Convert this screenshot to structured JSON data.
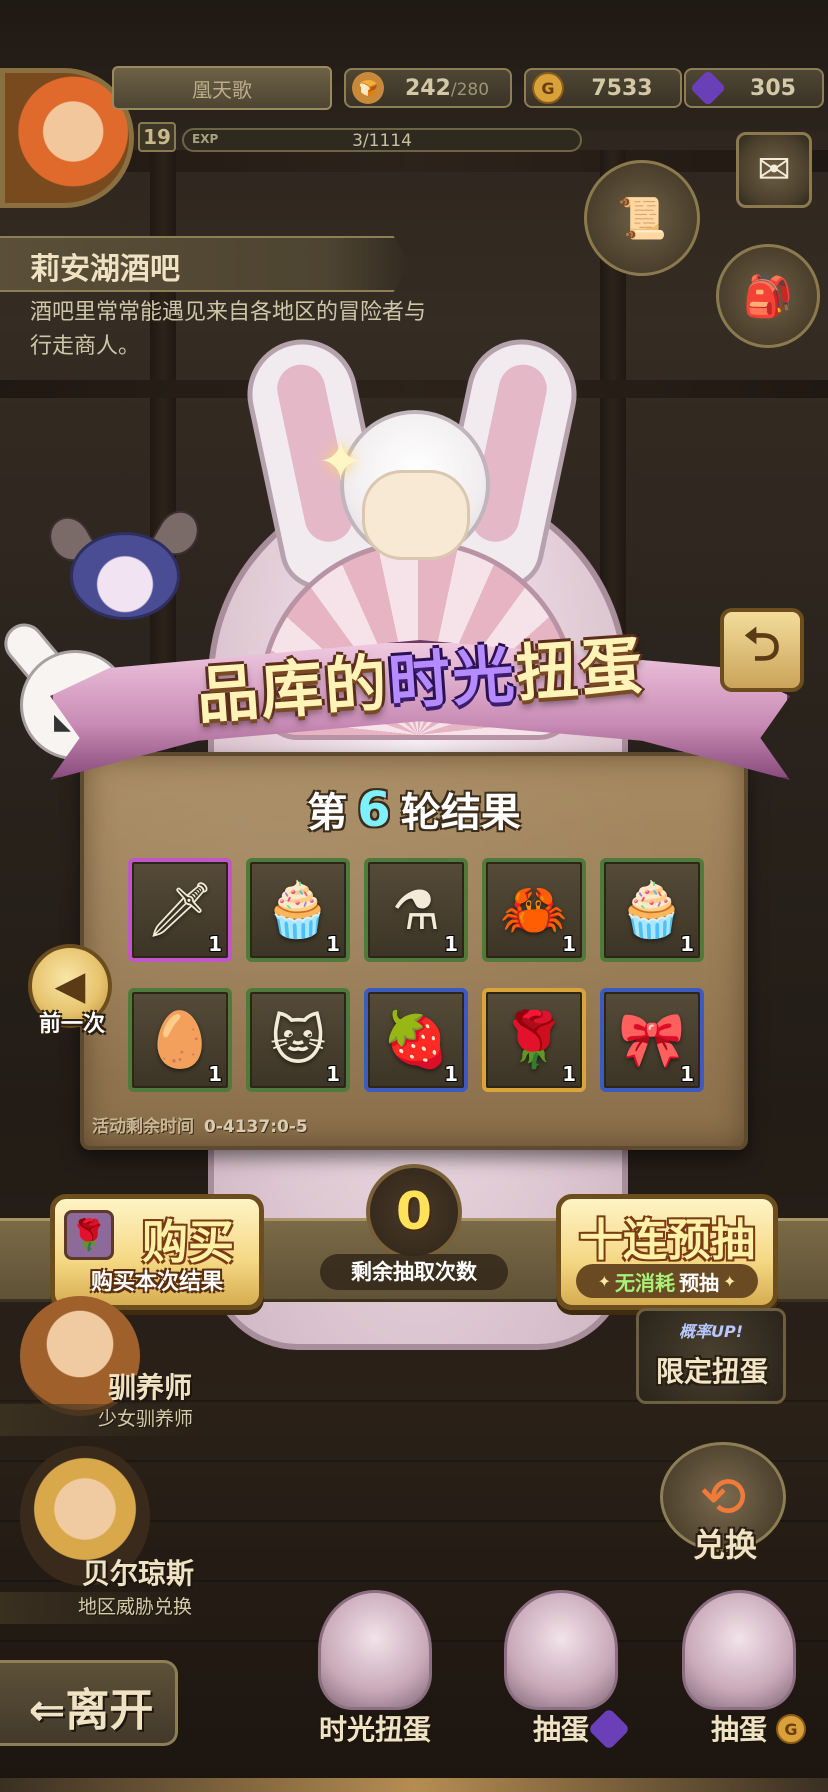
{
  "player": {
    "name": "凰天歌",
    "level": "19",
    "exp_label": "EXP",
    "exp_value": "3/1114"
  },
  "resources": {
    "stamina": {
      "value": "242",
      "max": "/280",
      "icon": "bread-icon"
    },
    "gold": {
      "value": "7533",
      "icon": "gold-coin-icon",
      "glyph": "G"
    },
    "gems": {
      "value": "305",
      "icon": "purple-gem-icon"
    }
  },
  "location": {
    "title": "莉安湖酒吧",
    "description": "酒吧里常常能遇见来自各地区的冒险者与行走商人。"
  },
  "banner": {
    "title_a": "品库的",
    "title_b": "时光",
    "title_c": "扭蛋"
  },
  "results": {
    "round_prefix": "第",
    "round_number": "6",
    "round_suffix": "轮结果",
    "time_left_label": "活动剩余时间",
    "time_left_value": "0-4137:0-5",
    "items": [
      {
        "name": "kunai",
        "glyph": "🗡",
        "qty": "1",
        "rarity_color": "#c056c8"
      },
      {
        "name": "pudding-chest",
        "glyph": "🧁",
        "qty": "1",
        "rarity_color": "#4f7a3a"
      },
      {
        "name": "potion-flask",
        "glyph": "⚗",
        "qty": "1",
        "rarity_color": "#4f7a3a"
      },
      {
        "name": "crab",
        "glyph": "🦀",
        "qty": "1",
        "rarity_color": "#4f7a3a"
      },
      {
        "name": "pudding-chest",
        "glyph": "🧁",
        "qty": "1",
        "rarity_color": "#4f7a3a"
      },
      {
        "name": "red-egg",
        "glyph": "🥚",
        "qty": "1",
        "rarity_color": "#4f7a3a"
      },
      {
        "name": "gray-cat-ears",
        "glyph": "🐱",
        "qty": "1",
        "rarity_color": "#4f7a3a"
      },
      {
        "name": "berry-tart",
        "glyph": "🍓",
        "qty": "1",
        "rarity_color": "#3d5bbf"
      },
      {
        "name": "rose-bouquet",
        "glyph": "🌹",
        "qty": "1",
        "rarity_color": "#d9a53a"
      },
      {
        "name": "pink-scarf",
        "glyph": "🎀",
        "qty": "1",
        "rarity_color": "#3d5bbf"
      }
    ]
  },
  "nav": {
    "prev_label": "前一次",
    "prev_glyph": "◀",
    "return_glyph": "⮌"
  },
  "actions": {
    "buy_title": "购买",
    "buy_sub": "购买本次结果",
    "draw_count": "0",
    "draw_count_label": "剩余抽取次数",
    "ten_draw_title": "十连预抽",
    "ten_draw_sub_a": "无消耗",
    "ten_draw_sub_b": "预抽"
  },
  "npcs": [
    {
      "name": "驯养师",
      "sub": "少女驯养师"
    },
    {
      "name": "贝尔琼斯",
      "sub": "地区威胁兑换"
    }
  ],
  "right_panel": {
    "limited_tag": "概率UP!",
    "limited_label": "限定扭蛋",
    "exchange_label": "兑换"
  },
  "dock": {
    "leave_label": "⇐离开",
    "items": [
      {
        "label": "时光扭蛋"
      },
      {
        "label": "抽蛋",
        "currency": "gem"
      },
      {
        "label": "抽蛋",
        "currency": "gold"
      }
    ]
  },
  "colors": {
    "accent_gold": "#f4d782",
    "round_number": "#7ef1ff",
    "draw_count": "#ffe25a",
    "no_cost_green": "#a8f27a"
  }
}
